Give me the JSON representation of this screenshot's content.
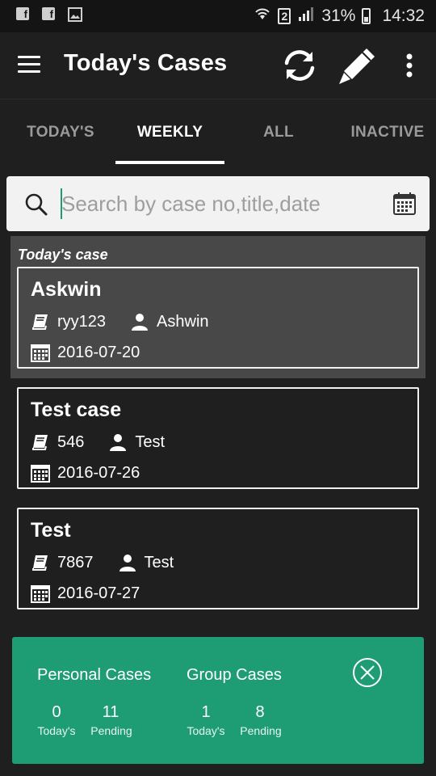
{
  "status_bar": {
    "notif_icons": [
      "facebook-icon",
      "facebook-icon",
      "image-icon"
    ],
    "sim_label": "2",
    "battery": "31%",
    "time": "14:32"
  },
  "app_bar": {
    "title": "Today's Cases",
    "actions": [
      "refresh-icon",
      "edit-pencil-icon",
      "more-vert-icon"
    ]
  },
  "tabs": [
    {
      "label": "TODAY'S",
      "active": false
    },
    {
      "label": "WEEKLY",
      "active": true
    },
    {
      "label": "ALL",
      "active": false
    },
    {
      "label": "INACTIVE",
      "active": false
    }
  ],
  "search": {
    "placeholder": "Search by case no,title,date",
    "value": ""
  },
  "section_label": "Today's case",
  "cases": [
    {
      "title": "Askwin",
      "case_no": "ryy123",
      "person": "Ashwin",
      "date": "2016-07-20",
      "highlighted": true
    },
    {
      "title": "Test case",
      "case_no": "546",
      "person": "Test",
      "date": "2016-07-26",
      "highlighted": false
    },
    {
      "title": "Test",
      "case_no": "7867",
      "person": "Test",
      "date": "2016-07-27",
      "highlighted": false
    }
  ],
  "summary": {
    "personal": {
      "heading": "Personal Cases",
      "todays_value": "0",
      "todays_label": "Today's",
      "pending_value": "11",
      "pending_label": "Pending"
    },
    "group": {
      "heading": "Group Cases",
      "todays_value": "1",
      "todays_label": "Today's",
      "pending_value": "8",
      "pending_label": "Pending"
    }
  },
  "colors": {
    "accent": "#1e9d74",
    "background": "#1f1f1f",
    "highlight": "#484848"
  }
}
